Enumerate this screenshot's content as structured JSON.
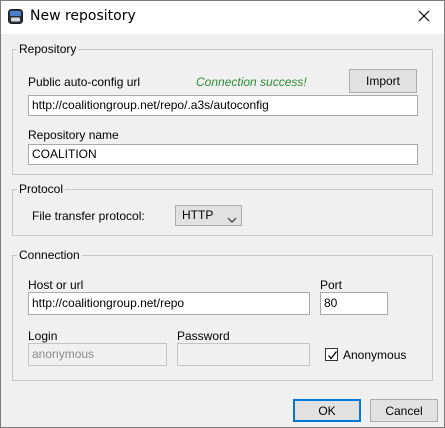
{
  "window": {
    "title": "New repository"
  },
  "repository": {
    "legend": "Repository",
    "autoconfig_label": "Public auto-config url",
    "status": "Connection success!",
    "status_color": "#2e8b37",
    "import_label": "Import",
    "autoconfig_value": "http://coalitiongroup.net/repo/.a3s/autoconfig",
    "name_label": "Repository name",
    "name_value": "COALITION"
  },
  "protocol": {
    "legend": "Protocol",
    "ftp_label": "File transfer protocol:",
    "ftp_value": "HTTP"
  },
  "connection": {
    "legend": "Connection",
    "host_label": "Host or url",
    "host_value": "http://coalitiongroup.net/repo",
    "port_label": "Port",
    "port_value": "80",
    "login_label": "Login",
    "login_value": "anonymous",
    "password_label": "Password",
    "password_value": "",
    "anonymous_label": "Anonymous",
    "anonymous_checked": true
  },
  "footer": {
    "ok_label": "OK",
    "cancel_label": "Cancel"
  },
  "icons": {
    "app": "app-icon",
    "close": "close-icon",
    "dropdown": "chevron-down-icon",
    "check": "checkmark-icon"
  },
  "colors": {
    "accent": "#0078d7",
    "success": "#2e8b37"
  }
}
